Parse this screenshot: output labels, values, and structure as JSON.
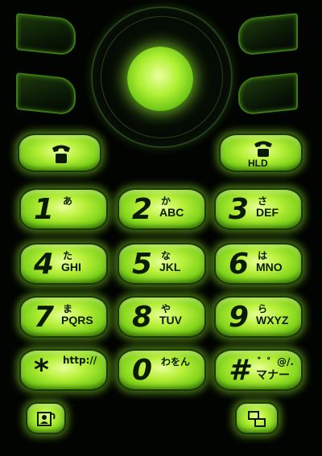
{
  "colors": {
    "glow": "#b8f03a",
    "background": "#020402",
    "legend": "#0b1a02"
  },
  "call_keys": {
    "send": {
      "icon": "phone-handset-icon"
    },
    "end": {
      "icon": "phone-hold-icon",
      "label": "HLD"
    }
  },
  "keys": [
    {
      "digit": "1",
      "kana": "あ",
      "letters": ""
    },
    {
      "digit": "2",
      "kana": "か",
      "letters": "ABC"
    },
    {
      "digit": "3",
      "kana": "さ",
      "letters": "DEF"
    },
    {
      "digit": "4",
      "kana": "た",
      "letters": "GHI"
    },
    {
      "digit": "5",
      "kana": "な",
      "letters": "JKL"
    },
    {
      "digit": "6",
      "kana": "は",
      "letters": "MNO"
    },
    {
      "digit": "7",
      "kana": "ま",
      "letters": "PQRS"
    },
    {
      "digit": "8",
      "kana": "や",
      "letters": "TUV"
    },
    {
      "digit": "9",
      "kana": "ら",
      "letters": "WXYZ"
    },
    {
      "digit": "*",
      "kana": "http://",
      "letters": ""
    },
    {
      "digit": "0",
      "kana": "わをん",
      "letters": ""
    },
    {
      "digit": "#",
      "kana": "゛゜@/.",
      "letters": "マナー"
    }
  ],
  "bottom_keys": {
    "left": {
      "icon": "contact-card-icon"
    },
    "right": {
      "icon": "window-switch-icon"
    }
  }
}
